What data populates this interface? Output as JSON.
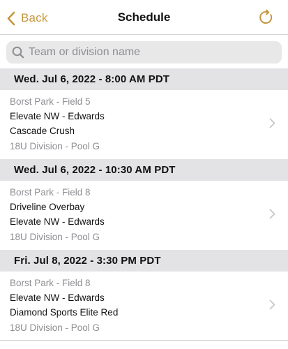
{
  "navbar": {
    "back_label": "Back",
    "title": "Schedule",
    "accent_color": "#c4973e",
    "back_icon": "chevron-left-icon",
    "refresh_icon": "refresh-icon"
  },
  "search": {
    "placeholder": "Team or division name",
    "value": "",
    "icon": "search-icon"
  },
  "schedule": [
    {
      "header": "Wed. Jul 6, 2022 - 8:00 AM PDT",
      "venue": "Borst Park - Field 5",
      "team1": "Elevate NW - Edwards",
      "team2": "Cascade Crush",
      "division": "18U Division - Pool G"
    },
    {
      "header": "Wed. Jul 6, 2022 - 10:30 AM PDT",
      "venue": "Borst Park - Field 8",
      "team1": "Driveline Overbay",
      "team2": "Elevate NW - Edwards",
      "division": "18U Division - Pool G"
    },
    {
      "header": "Fri. Jul 8, 2022 - 3:30 PM PDT",
      "venue": "Borst Park - Field 8",
      "team1": "Elevate NW - Edwards",
      "team2": "Diamond Sports Elite Red",
      "division": "18U Division - Pool G"
    }
  ]
}
